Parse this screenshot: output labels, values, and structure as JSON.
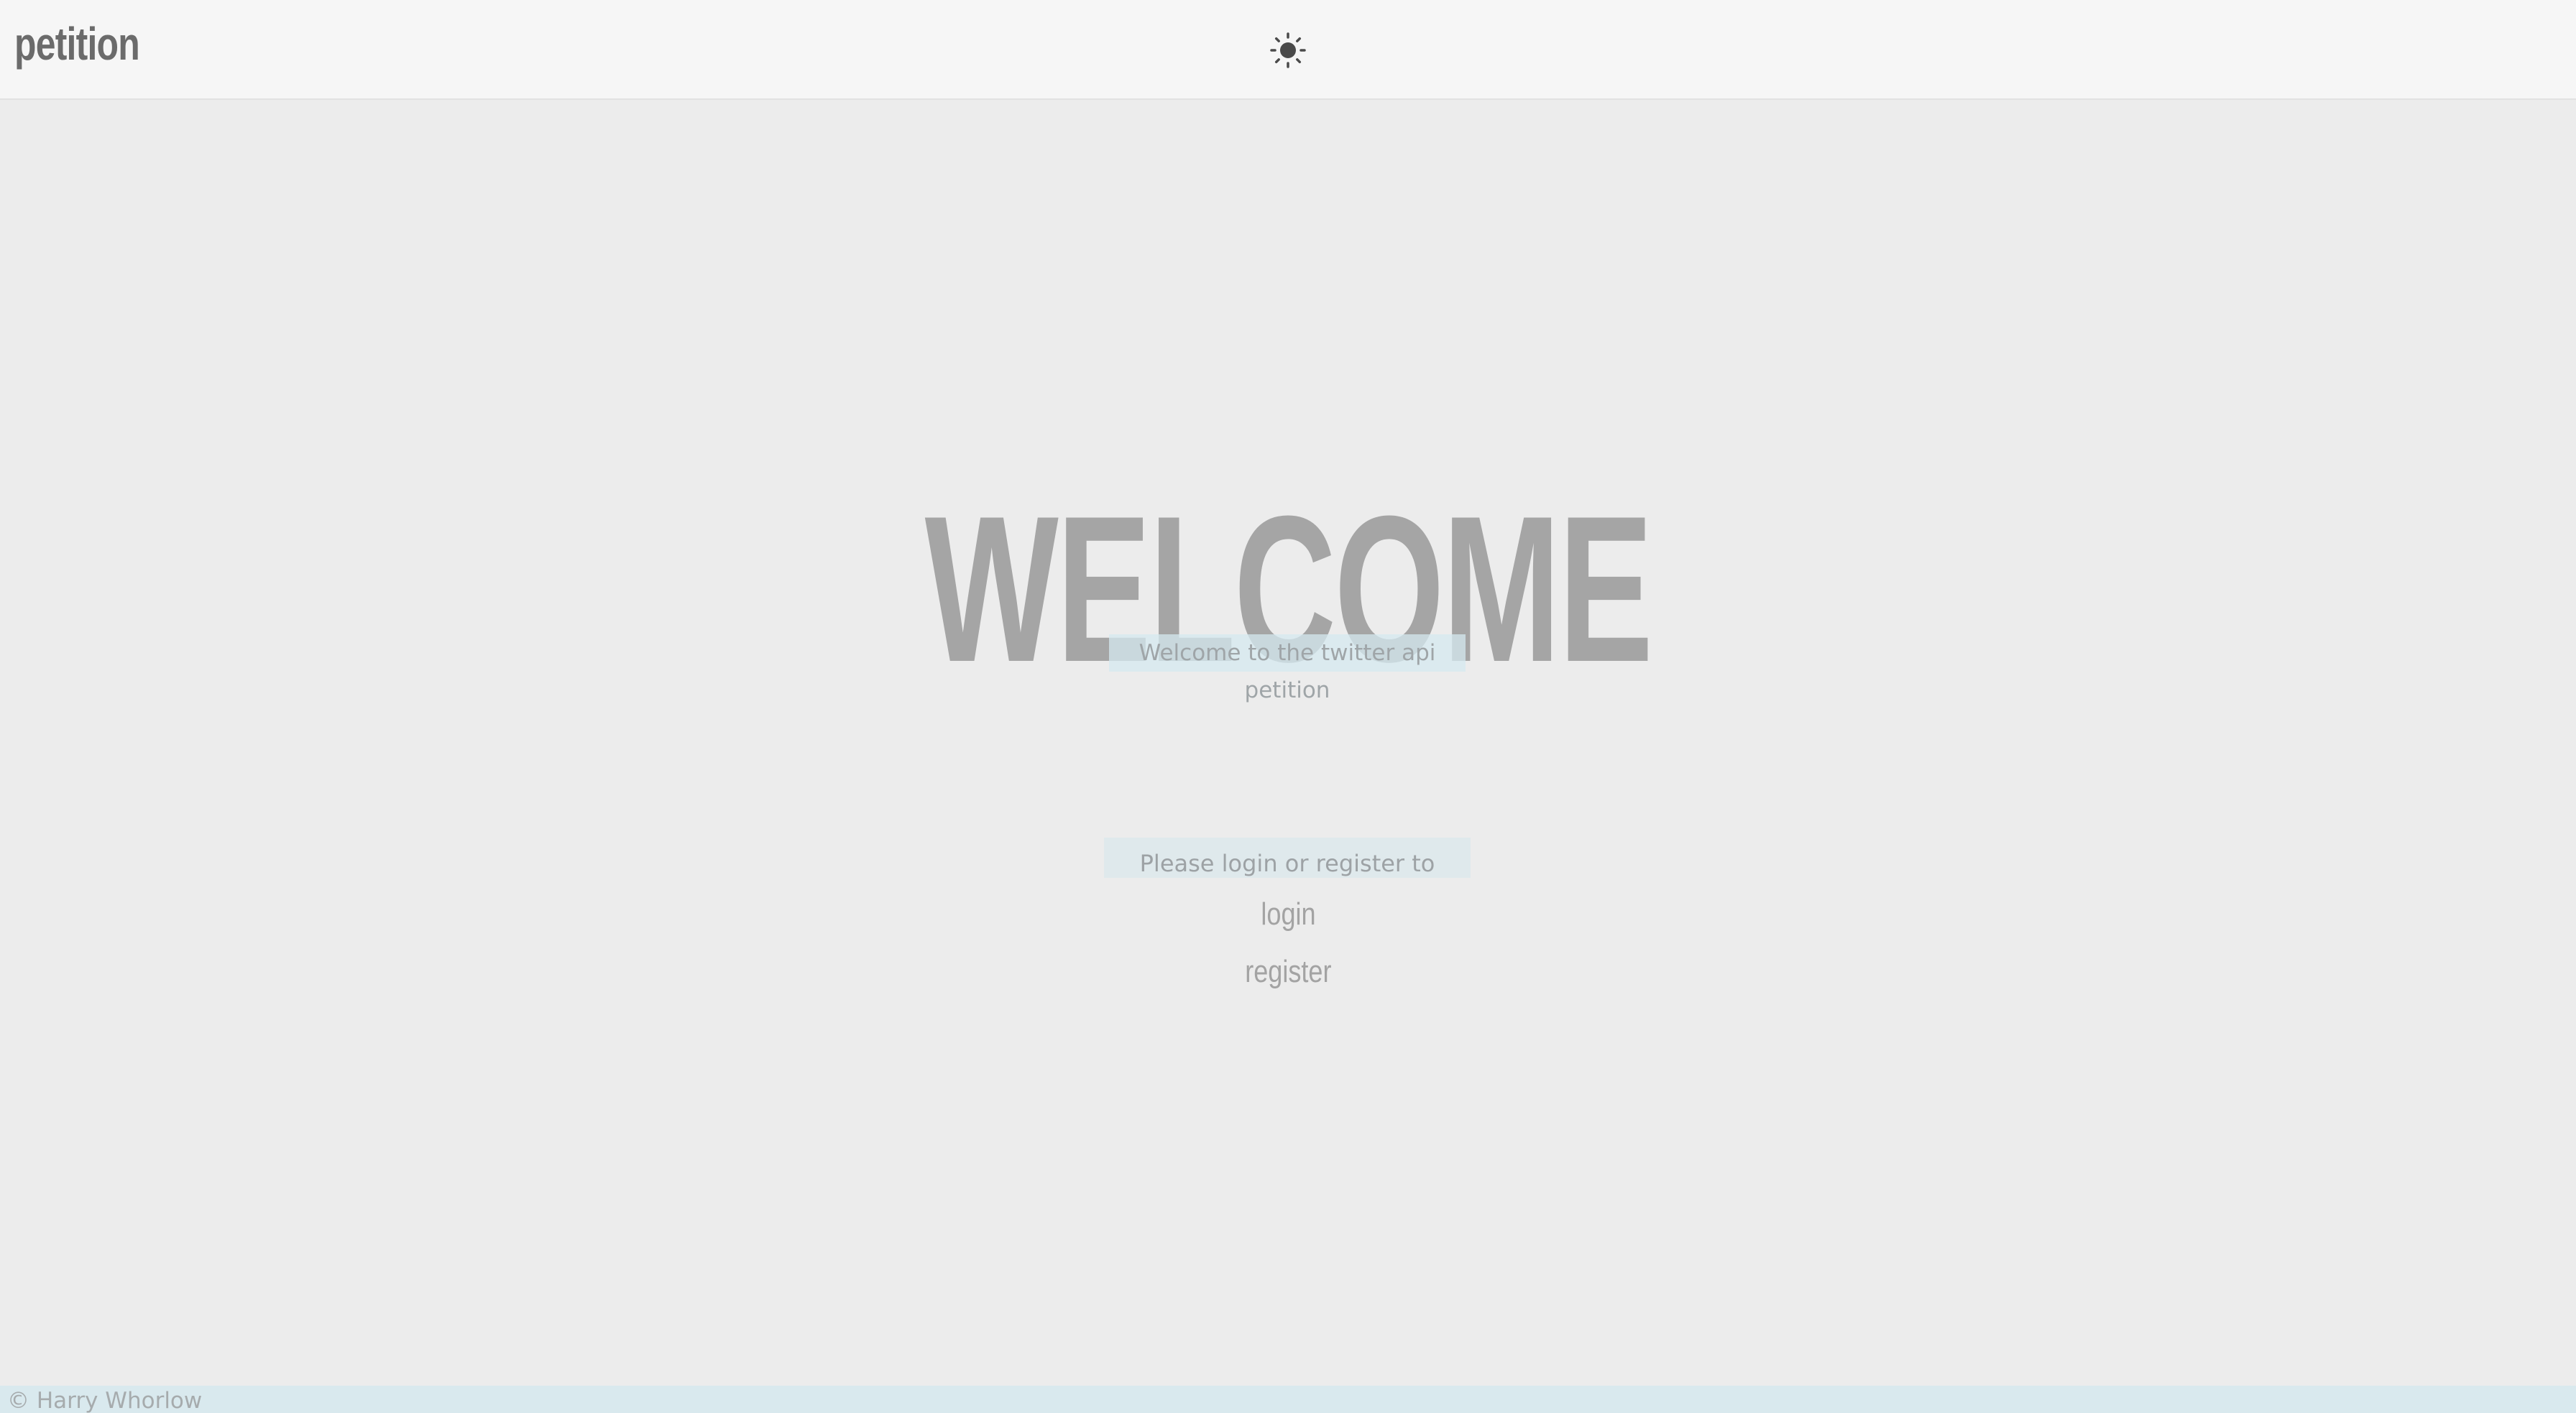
{
  "header": {
    "brand": "petition",
    "theme_toggle_icon": "sun-icon"
  },
  "hero": {
    "title": "WELCOME",
    "subtitle": "Welcome to the twitter api petition"
  },
  "auth": {
    "prompt": "Please login or register to continue.",
    "login_label": "login",
    "register_label": "register"
  },
  "footer": {
    "copyright": "© Harry Whorlow"
  },
  "colors": {
    "header_bg": "#f6f6f6",
    "page_bg": "#ececec",
    "highlight_bg": "#d9e9ee",
    "title_text": "#a5a5a5",
    "brand_text": "#6b6b6b"
  }
}
